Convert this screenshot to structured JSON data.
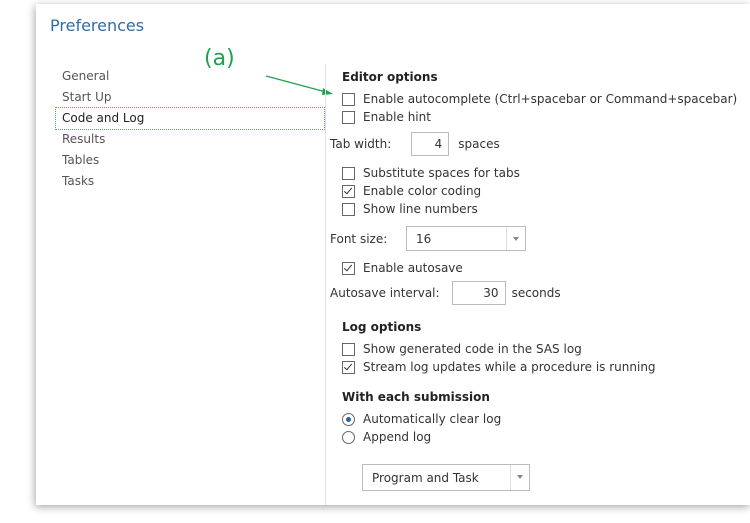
{
  "dialog": {
    "title": "Preferences"
  },
  "annotation": "(a)",
  "sidebar": {
    "items": [
      {
        "label": "General"
      },
      {
        "label": "Start Up"
      },
      {
        "label": "Code and Log"
      },
      {
        "label": "Results"
      },
      {
        "label": "Tables"
      },
      {
        "label": "Tasks"
      }
    ],
    "selected": "Code and Log"
  },
  "editor": {
    "heading": "Editor options",
    "enable_autocomplete": {
      "label": "Enable autocomplete (Ctrl+spacebar or Command+spacebar)",
      "checked": false
    },
    "enable_hint": {
      "label": "Enable hint",
      "checked": false
    },
    "tab_width": {
      "label": "Tab width:",
      "value": "4",
      "unit": "spaces"
    },
    "substitute_spaces": {
      "label": "Substitute spaces for tabs",
      "checked": false
    },
    "enable_color_coding": {
      "label": "Enable color coding",
      "checked": true
    },
    "show_line_numbers": {
      "label": "Show line numbers",
      "checked": false
    },
    "font_size": {
      "label": "Font size:",
      "value": "16"
    },
    "enable_autosave": {
      "label": "Enable autosave",
      "checked": true
    },
    "autosave_interval": {
      "label": "Autosave interval:",
      "value": "30",
      "unit": "seconds"
    }
  },
  "log": {
    "heading": "Log options",
    "show_generated_code": {
      "label": "Show generated code in the SAS log",
      "checked": false
    },
    "stream_log_updates": {
      "label": "Stream log updates while a procedure is running",
      "checked": true
    }
  },
  "submission": {
    "heading": "With each submission",
    "options": [
      {
        "label": "Automatically clear log",
        "checked": true
      },
      {
        "label": "Append log",
        "checked": false
      }
    ],
    "append_target": {
      "value": "Program and Task"
    }
  },
  "colors": {
    "title": "#2d6da8",
    "annotation": "#20a050",
    "radio_dot": "#2d5fa8"
  }
}
